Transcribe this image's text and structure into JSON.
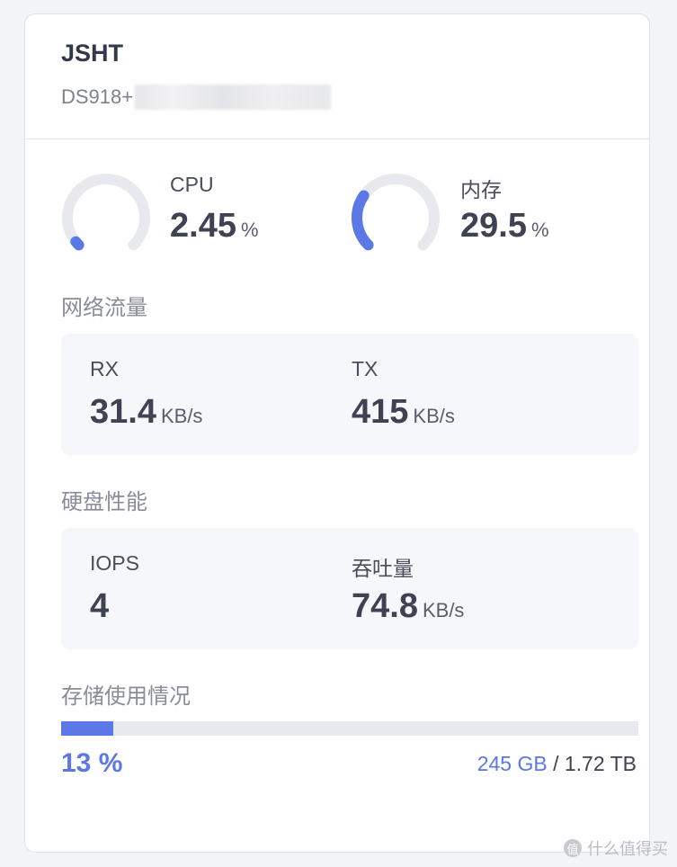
{
  "device": {
    "name": "JSHT",
    "model": "DS918+"
  },
  "cpu": {
    "label": "CPU",
    "value": "2.45",
    "unit": "%",
    "percent": 2.45
  },
  "memory": {
    "label": "内存",
    "value": "29.5",
    "unit": "%",
    "percent": 29.5
  },
  "network": {
    "title": "网络流量",
    "rx": {
      "label": "RX",
      "value": "31.4",
      "unit": "KB/s"
    },
    "tx": {
      "label": "TX",
      "value": "415",
      "unit": "KB/s"
    }
  },
  "disk": {
    "title": "硬盘性能",
    "iops": {
      "label": "IOPS",
      "value": "4"
    },
    "throughput": {
      "label": "吞吐量",
      "value": "74.8",
      "unit": "KB/s"
    }
  },
  "storage": {
    "title": "存储使用情况",
    "percent_text": "13 %",
    "percent": 13,
    "used": "245 GB",
    "separator": " / ",
    "total": "1.72 TB"
  },
  "colors": {
    "accent": "#5b78e6",
    "track": "#e8e9ee"
  },
  "watermark": {
    "text": "什么值得买"
  }
}
